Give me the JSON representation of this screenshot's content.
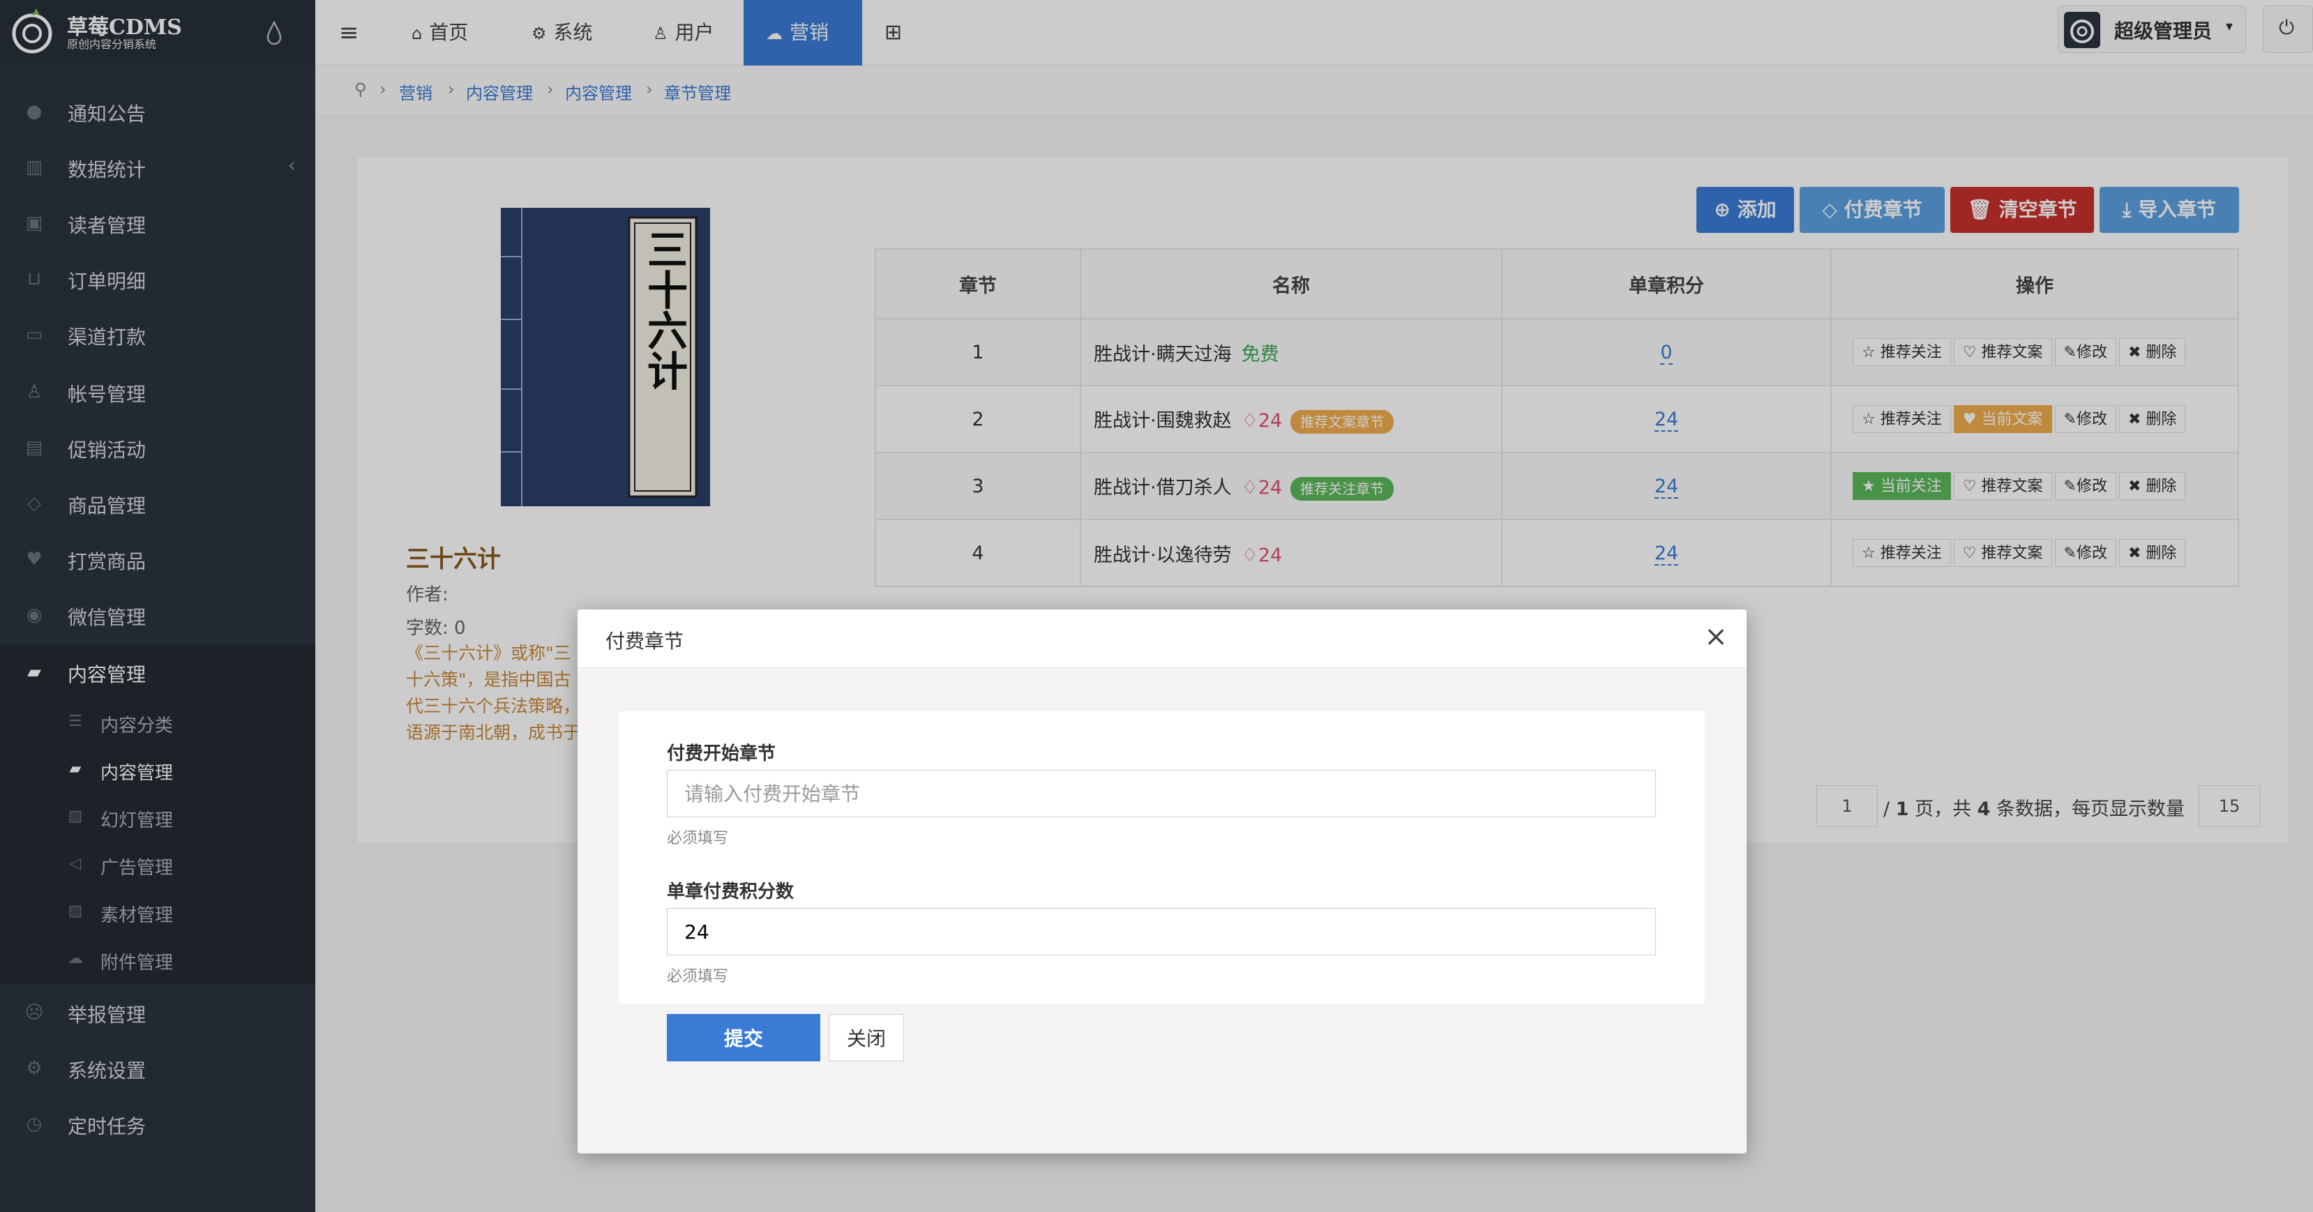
{
  "brand": {
    "name": "草莓CDMS",
    "subtitle": "原创内容分销系统"
  },
  "sidebar": {
    "items": [
      {
        "label": "通知公告",
        "icon": "comment-icon"
      },
      {
        "label": "数据统计",
        "icon": "bar-chart-icon"
      },
      {
        "label": "读者管理",
        "icon": "lock-icon"
      },
      {
        "label": "订单明细",
        "icon": "cart-icon"
      },
      {
        "label": "渠道打款",
        "icon": "card-icon"
      },
      {
        "label": "帐号管理",
        "icon": "user-icon"
      },
      {
        "label": "促销活动",
        "icon": "briefcase-icon"
      },
      {
        "label": "商品管理",
        "icon": "diamond-icon"
      },
      {
        "label": "打赏商品",
        "icon": "heart-icon"
      },
      {
        "label": "微信管理",
        "icon": "wechat-icon"
      },
      {
        "label": "内容管理",
        "icon": "book-icon"
      },
      {
        "label": "举报管理",
        "icon": "frown-icon"
      },
      {
        "label": "系统设置",
        "icon": "gear-icon"
      },
      {
        "label": "定时任务",
        "icon": "clock-icon"
      }
    ],
    "submenu": [
      {
        "label": "内容分类",
        "icon": "list-icon"
      },
      {
        "label": "内容管理",
        "icon": "book-icon"
      },
      {
        "label": "幻灯管理",
        "icon": "image-icon"
      },
      {
        "label": "广告管理",
        "icon": "bullhorn-icon"
      },
      {
        "label": "素材管理",
        "icon": "image-icon"
      },
      {
        "label": "附件管理",
        "icon": "cloud-icon"
      }
    ]
  },
  "topnav": {
    "home": "首页",
    "system": "系统",
    "user": "用户",
    "marketing": "营销",
    "admin": "超级管理员"
  },
  "breadcrumb": [
    "营销",
    "内容管理",
    "内容管理",
    "章节管理"
  ],
  "book": {
    "title": "三十六计",
    "author": "作者:",
    "words": "字数: 0",
    "desc": "《三十六计》或称\"三十六策\"，是指中国古代三十六个兵法策略，语源于南北朝，成书于明清。它是根据我国古代卓越的军事思想和丰富的斗争经验总结而成的兵书，是中华民族悠久文化遗产之一。",
    "cover_text": "三十六计"
  },
  "toolbar": {
    "add": "添加",
    "paid": "付费章节",
    "clear": "清空章节",
    "import": "导入章节"
  },
  "table": {
    "headers": [
      "章节",
      "名称",
      "单章积分",
      "操作"
    ],
    "rows": [
      {
        "no": "1",
        "name": "胜战计·瞒天过海",
        "free": "免费",
        "points": "0",
        "ops": [
          "推荐关注",
          "推荐文案",
          "修改",
          "删除"
        ]
      },
      {
        "no": "2",
        "name": "胜战计·围魏救赵",
        "gem": "24",
        "tag": "推荐文案章节",
        "points": "24",
        "ops": [
          "推荐关注",
          "当前文案",
          "修改",
          "删除"
        ]
      },
      {
        "no": "3",
        "name": "胜战计·借刀杀人",
        "gem": "24",
        "tag": "推荐关注章节",
        "points": "24",
        "ops": [
          "当前关注",
          "推荐文案",
          "修改",
          "删除"
        ]
      },
      {
        "no": "4",
        "name": "胜战计·以逸待劳",
        "gem": "24",
        "points": "24",
        "ops": [
          "推荐关注",
          "推荐文案",
          "修改",
          "删除"
        ]
      }
    ]
  },
  "pager": {
    "page": "1",
    "summary_a": "/ ",
    "total_pages": "1",
    "summary_b": " 页，共 ",
    "total": "4",
    "summary_c": " 条数据，每页显示数量",
    "per_page": "15"
  },
  "modal": {
    "title": "付费章节",
    "field1_label": "付费开始章节",
    "field1_placeholder": "请输入付费开始章节",
    "field1_value": "",
    "field1_hint": "必须填写",
    "field2_label": "单章付费积分数",
    "field2_value": "24",
    "field2_hint": "必须填写",
    "submit": "提交",
    "close": "关闭"
  },
  "colors": {
    "primary": "#3a7bd5",
    "sidebar": "#2c3440",
    "danger": "#c9302c",
    "warning": "#f0ad4e",
    "success": "#5cb85c",
    "info": "#5aa0e0"
  }
}
